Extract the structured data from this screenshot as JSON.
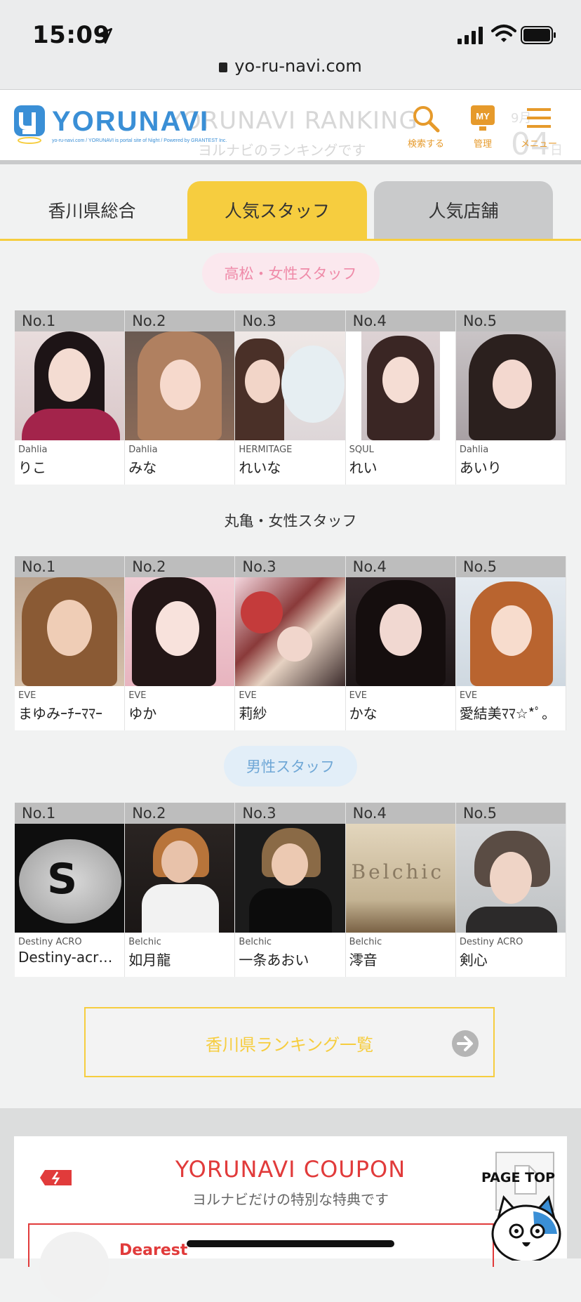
{
  "status_bar": {
    "time": "15:09",
    "url": "yo-ru-navi.com"
  },
  "header": {
    "logo_text": "YORUNAVI",
    "logo_tagline": "yo-ru-navi.com / YORUNAVI is portal site of Night / Powered by GRANTEST Inc.",
    "ghost_title": "YORUNAVI RANKING",
    "ghost_subtitle": "ヨルナビのランキングです",
    "ghost_date_month": "9月",
    "ghost_date_day": "04",
    "ghost_date_suffix": "日",
    "search_label": "検索する",
    "manage_label": "管理",
    "manage_badge": "MY",
    "menu_label": "メニュー"
  },
  "tabs": [
    {
      "label": "香川県総合"
    },
    {
      "label": "人気スタッフ"
    },
    {
      "label": "人気店舗"
    }
  ],
  "sections": [
    {
      "title": "高松・女性スタッフ",
      "cards": [
        {
          "rank": "No.1",
          "shop": "Dahlia",
          "name": "りこ"
        },
        {
          "rank": "No.2",
          "shop": "Dahlia",
          "name": "みな"
        },
        {
          "rank": "No.3",
          "shop": "HERMITAGE",
          "name": "れいな"
        },
        {
          "rank": "No.4",
          "shop": "SQUL",
          "name": "れい"
        },
        {
          "rank": "No.5",
          "shop": "Dahlia",
          "name": "あいり"
        }
      ]
    },
    {
      "title": "丸亀・女性スタッフ",
      "cards": [
        {
          "rank": "No.1",
          "shop": "EVE",
          "name": "まゆみｰﾁｰﾏﾏｰ"
        },
        {
          "rank": "No.2",
          "shop": "EVE",
          "name": "ゆか"
        },
        {
          "rank": "No.3",
          "shop": "EVE",
          "name": "莉紗"
        },
        {
          "rank": "No.4",
          "shop": "EVE",
          "name": "かな"
        },
        {
          "rank": "No.5",
          "shop": "EVE",
          "name": "愛結美ﾏﾏ☆*ﾟ。"
        }
      ]
    },
    {
      "title": "男性スタッフ",
      "cards": [
        {
          "rank": "No.1",
          "shop": "Destiny ACRO",
          "name": "Destiny-acr…"
        },
        {
          "rank": "No.2",
          "shop": "Belchic",
          "name": "如月龍"
        },
        {
          "rank": "No.3",
          "shop": "Belchic",
          "name": "一条あおい"
        },
        {
          "rank": "No.4",
          "shop": "Belchic",
          "name": "澪音"
        },
        {
          "rank": "No.5",
          "shop": "Destiny ACRO",
          "name": "剣心"
        }
      ]
    }
  ],
  "belchic_photo_text": "Belchic",
  "cap_letter": "S",
  "ranking_list_button": "香川県ランキング一覧",
  "coupon": {
    "title": "YORUNAVI COUPON",
    "subtitle": "ヨルナビだけの特別な特典です",
    "first_shop": "Dearest"
  },
  "page_top_label": "PAGE TOP",
  "colors": {
    "accent_yellow": "#f6cd3f",
    "pink": "#ef8aa8",
    "blue": "#6fa7d6",
    "coupon_red": "#e13b3b",
    "orange": "#e69a2b"
  }
}
